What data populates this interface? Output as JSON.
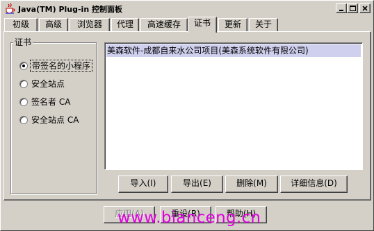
{
  "window": {
    "title": "Java(TM) Plug-in 控制面板",
    "icon": "java-coffee-cup-icon",
    "controls": [
      "minimize-icon",
      "maximize-icon",
      "close-icon"
    ]
  },
  "tabs": [
    {
      "label": "初级",
      "active": false
    },
    {
      "label": "高级",
      "active": false
    },
    {
      "label": "浏览器",
      "active": false
    },
    {
      "label": "代理",
      "active": false
    },
    {
      "label": "高速缓存",
      "active": false
    },
    {
      "label": "证书",
      "active": true
    },
    {
      "label": "更新",
      "active": false
    },
    {
      "label": "关于",
      "active": false
    }
  ],
  "certificates": {
    "group_title": "证书",
    "options": [
      {
        "label": "带签名的小程序",
        "selected": true
      },
      {
        "label": "安全站点",
        "selected": false
      },
      {
        "label": "签名者 CA",
        "selected": false
      },
      {
        "label": "安全站点 CA",
        "selected": false
      }
    ],
    "list_items": [
      "美森软件-成都自来水公司项目(美森系统软件有限公司)"
    ],
    "list_selection_color": "#cfcfee"
  },
  "actions": {
    "import_label": "导入(I)",
    "export_label": "导出(E)",
    "remove_label": "删除(M)",
    "details_label": "详细信息(D)"
  },
  "footer": {
    "apply_label": "应用(A)",
    "apply_enabled": false,
    "reset_label": "重设(R)",
    "help_label": "帮助(H)"
  },
  "watermark": {
    "text": "www.bianceng.cn",
    "color": "#e000e0"
  }
}
